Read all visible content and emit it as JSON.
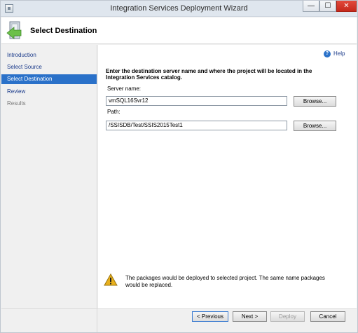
{
  "window": {
    "title": "Integration Services Deployment Wizard",
    "minimize": "—",
    "maximize": "☐",
    "close": "✕"
  },
  "header": {
    "title": "Select Destination"
  },
  "nav": {
    "items": [
      {
        "label": "Introduction",
        "state": "done"
      },
      {
        "label": "Select Source",
        "state": "done"
      },
      {
        "label": "Select Destination",
        "state": "active"
      },
      {
        "label": "Review",
        "state": "next"
      },
      {
        "label": "Results",
        "state": "disabled"
      }
    ]
  },
  "help": {
    "label": "Help",
    "icon": "?"
  },
  "instruction": "Enter the destination server name and where the project will be located in the Integration Services catalog.",
  "server": {
    "label": "Server name:",
    "value": "vmSQL16Svr12",
    "browse": "Browse..."
  },
  "path": {
    "label": "Path:",
    "value": "/SSISDB/Test/SSIS2015Test1",
    "browse": "Browse..."
  },
  "warning": "The packages would be deployed to selected project. The same name packages would be replaced.",
  "buttons": {
    "previous": "< Previous",
    "next": "Next >",
    "deploy": "Deploy",
    "cancel": "Cancel"
  },
  "colors": {
    "accent": "#2a71c9",
    "close": "#c5281b",
    "warning": "#e8b01c"
  }
}
